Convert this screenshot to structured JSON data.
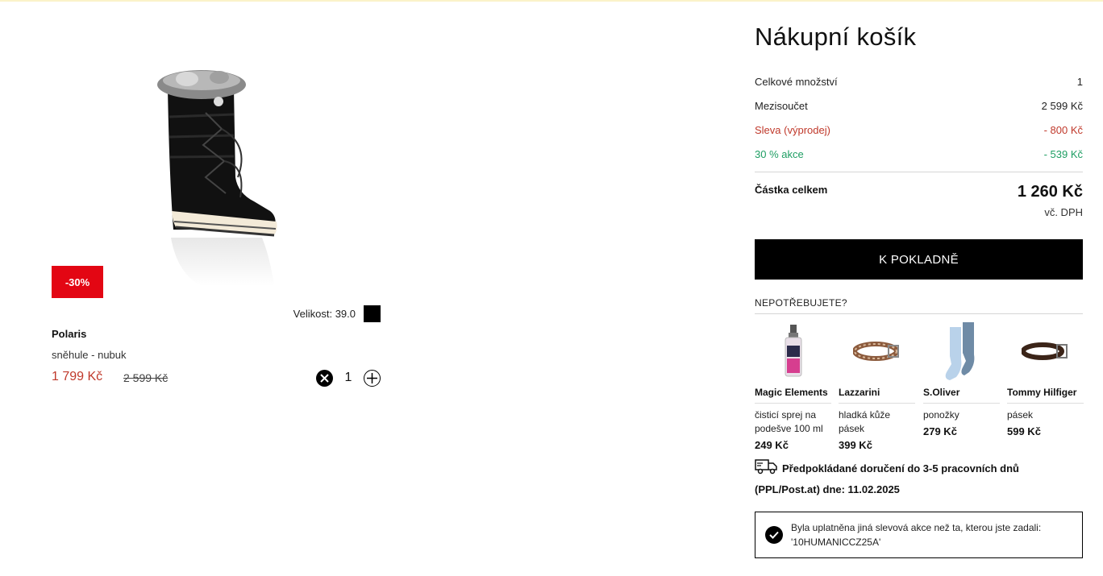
{
  "product": {
    "badge": "-30%",
    "size_label": "Velikost: 39.0",
    "brand": "Polaris",
    "description": "sněhule - nubuk",
    "price": "1 799 Kč",
    "old_price": "2 599 Kč",
    "quantity": "1"
  },
  "cart": {
    "title": "Nákupní košík",
    "rows": [
      {
        "label": "Celkové množství",
        "value": "1"
      },
      {
        "label": "Mezisoučet",
        "value": "2 599 Kč"
      },
      {
        "label": "Sleva (výprodej)",
        "value": "- 800 Kč"
      },
      {
        "label": "30 % akce",
        "value": "- 539 Kč"
      }
    ],
    "total_label": "Částka celkem",
    "total_value": "1 260 Kč",
    "vat_note": "vč. DPH",
    "checkout_label": "K POKLADNĚ"
  },
  "recommendations": {
    "title": "NEPOTŘEBUJETE?",
    "items": [
      {
        "brand": "Magic Elements",
        "desc": "čisticí sprej na podešve 100 ml",
        "price": "249 Kč",
        "icon": "spray-bottle"
      },
      {
        "brand": "Lazzarini",
        "desc": "hladká kůže pásek",
        "price": "399 Kč",
        "icon": "belt-patterned"
      },
      {
        "brand": "S.Oliver",
        "desc": "ponožky",
        "price": "279 Kč",
        "icon": "socks"
      },
      {
        "brand": "Tommy Hilfiger",
        "desc": "pásek",
        "price": "599 Kč",
        "icon": "belt-brown"
      }
    ]
  },
  "delivery": {
    "line1": "Předpokládané doručení do 3-5 pracovních dnů",
    "line2": "(PPL/Post.at) dne:  11.02.2025"
  },
  "notice": {
    "text": "Byla uplatněna jiná slevová akce než ta, kterou jste zadali: '10HUMANICCZ25A'"
  },
  "colors": {
    "badge": "#e30613",
    "discount_red": "#c0392b",
    "promo_green": "#1e9e63",
    "checkout_bg": "#000000"
  }
}
